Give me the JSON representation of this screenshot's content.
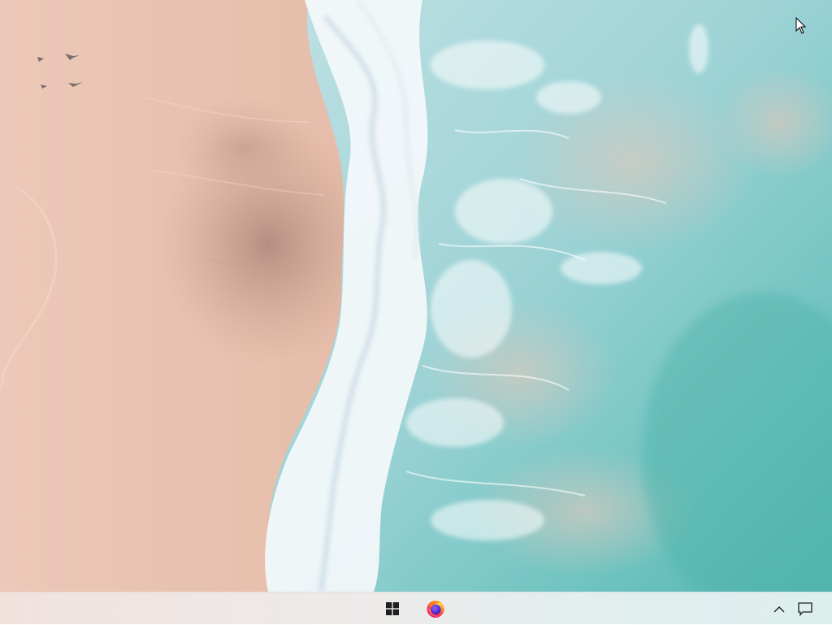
{
  "desktop": {
    "wallpaper": "aerial-beach-waves",
    "colors": {
      "sand": "#e9c7b6",
      "foam": "#f4f8fa",
      "shallow_water": "#a6d9da",
      "sea": "#5fbcb8"
    }
  },
  "taskbar": {
    "start": {
      "icon": "windows-logo-icon"
    },
    "apps": [
      {
        "icon": "firefox-icon"
      }
    ],
    "tray": {
      "chevron_icon": "chevron-up-icon",
      "notification_icon": "action-center-icon"
    }
  }
}
